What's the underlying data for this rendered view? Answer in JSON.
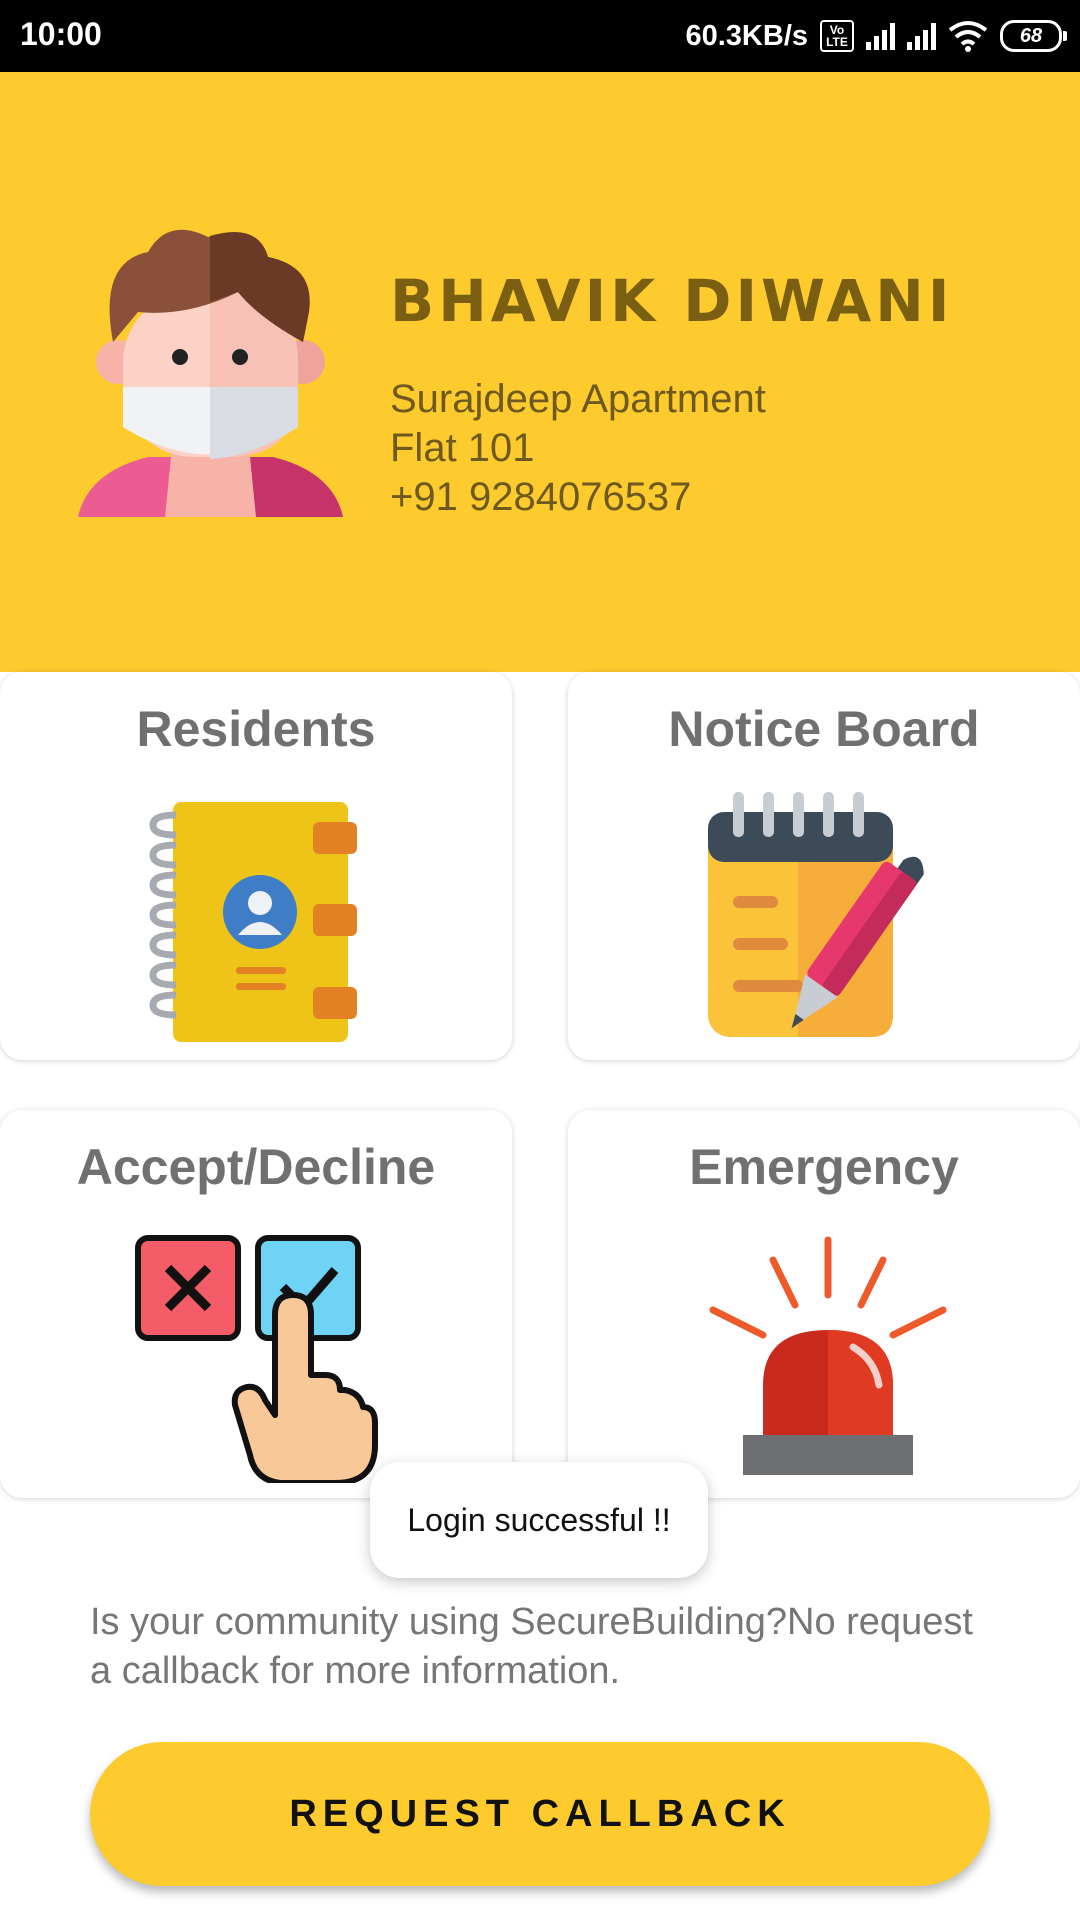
{
  "status_bar": {
    "time": "10:00",
    "net_speed": "60.3KB/s",
    "volte": "Vo LTE",
    "battery": "68"
  },
  "profile": {
    "name": "BHAVIK DIWANI",
    "building": "Surajdeep Apartment",
    "flat": "Flat 101",
    "phone": "+91 9284076537"
  },
  "cards": {
    "residents": "Residents",
    "notice_board": "Notice Board",
    "accept_decline": "Accept/Decline",
    "emergency": "Emergency"
  },
  "toast": "Login successful !!",
  "info_text": "Is your community using SecureBuilding?No request a callback for more information.",
  "cta_label": "REQUEST CALLBACK",
  "colors": {
    "accent": "#fdcb2e",
    "card_title": "#707070"
  },
  "icons": [
    "avatar-mask-icon",
    "contact-book-icon",
    "notepad-pen-icon",
    "accept-decline-icon",
    "siren-icon"
  ]
}
